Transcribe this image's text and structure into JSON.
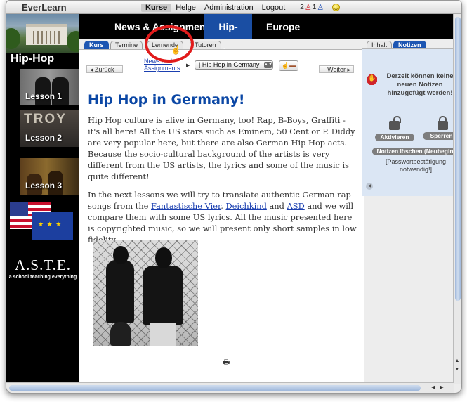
{
  "app": {
    "logo": "EverLearn"
  },
  "topnav": {
    "items": [
      {
        "label": "Kurse",
        "active": true
      },
      {
        "label": "Helge",
        "active": false
      },
      {
        "label": "Administration",
        "active": false
      },
      {
        "label": "Logout",
        "active": false
      }
    ],
    "status": {
      "count_red": "2",
      "count_blue": "1"
    }
  },
  "sidebar": {
    "title": "Hip-Hop",
    "lessons": [
      "Lesson 1",
      "Lesson 2",
      "Lesson 3"
    ],
    "lesson2_overlay": "TROY",
    "school_name": "A.S.T.E.",
    "school_tagline": "a school teaching everything"
  },
  "sections": [
    {
      "label": "News & Assignments",
      "active": false
    },
    {
      "label": "Hip-Hop",
      "active": true
    },
    {
      "label": "Europe",
      "active": false
    }
  ],
  "tabs": {
    "left": [
      {
        "label": "Kurs",
        "active": true
      },
      {
        "label": "Termine",
        "active": false
      },
      {
        "label": "Lernende",
        "active": false
      },
      {
        "label": "Tutoren",
        "active": false
      }
    ],
    "right": [
      {
        "label": "Inhalt",
        "active": false
      },
      {
        "label": "Notizen",
        "active": true
      }
    ]
  },
  "pagenav": {
    "back": "Zurück",
    "next": "Weiter",
    "breadcrumb": "News and Assignments",
    "selected_page": "| Hip Hop in Germany"
  },
  "article": {
    "title": "Hip Hop in Germany!",
    "p1": "Hip Hop culture is alive in Germany, too! Rap, B-Boys, Graffiti - it's all here! All the US stars such as Eminem, 50 Cent or P. Diddy are very popular here, but there are also German Hip Hop acts. Because the socio-cultural background of the artists is very different from the US artists, the lyrics and some of the music is quite different!",
    "p2_start": "In the next lessons we will try to translate authentic German rap songs from the ",
    "link1": "Fantastische Vier",
    "sep1": ", ",
    "link2": "Deichkind",
    "sep2": " and ",
    "link3": "ASD",
    "p2_end": " and we will compare them with some US lyrics. All the music presented here is copyrighted music, so we will present only short samples in low fidelity."
  },
  "notes": {
    "notice": "Derzeit können keine neuen Notizen hinzugefügt werden!",
    "activate": "Aktivieren",
    "lock": "Sperren",
    "delete": "Notizen löschen (Neubeginn)",
    "password_hint": "[Passwortbestätigung notwendig!]"
  },
  "colors": {
    "accent": "#1a4ea3",
    "highlight": "#e11b1b"
  },
  "icons": {
    "print": "printer-icon",
    "stop": "stop-hand-icon",
    "lock_open": "lock-open-icon",
    "lock_closed": "lock-closed-icon"
  }
}
